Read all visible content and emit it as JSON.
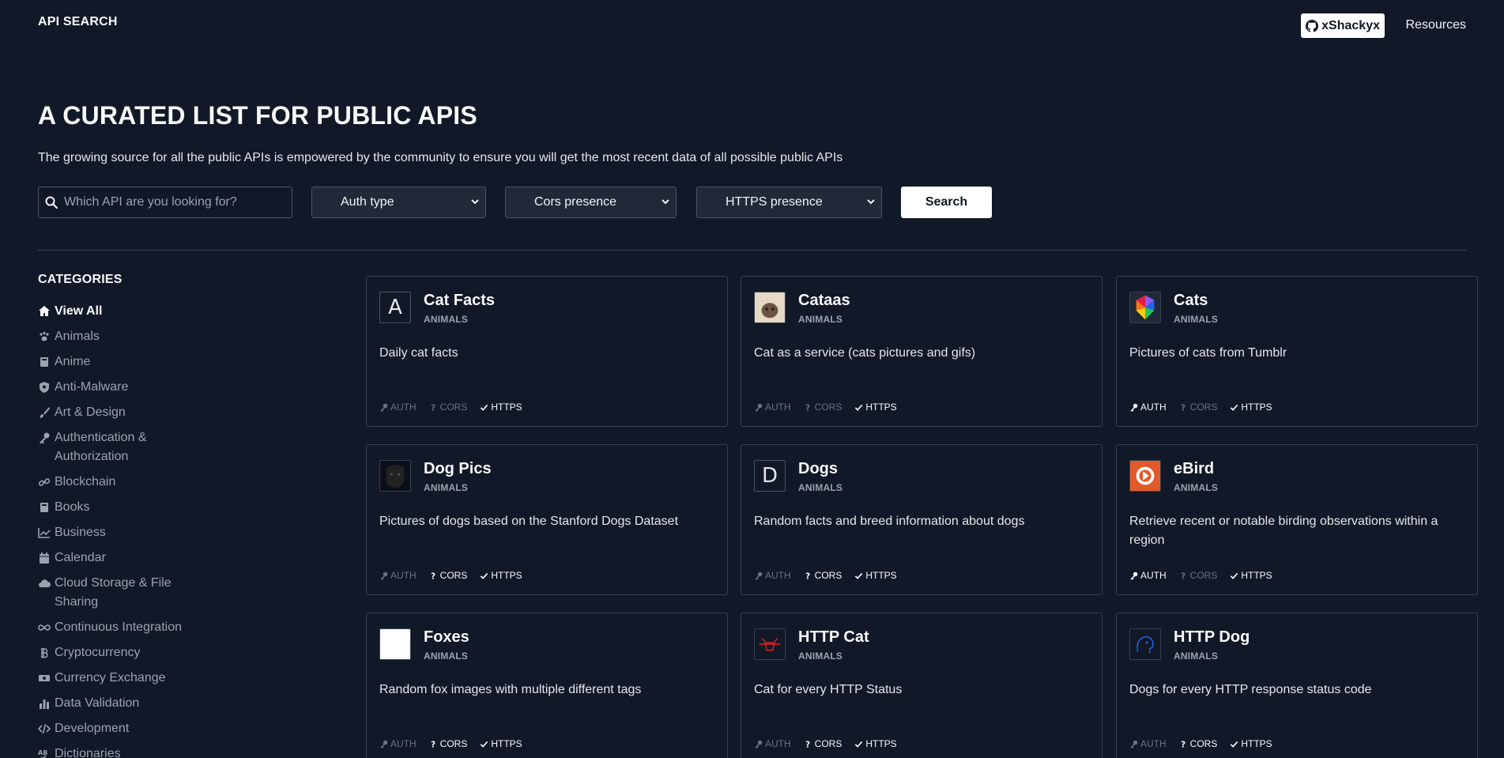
{
  "header": {
    "brand": "API SEARCH",
    "github_label": "xShackyx",
    "resources_label": "Resources"
  },
  "hero": {
    "title": "A CURATED LIST FOR PUBLIC APIS",
    "subtitle": "The growing source for all the public APIs is empowered by the community to ensure you will get the most recent data of all possible public APIs"
  },
  "filters": {
    "search_placeholder": "Which API are you looking for?",
    "auth_selected": "Auth type",
    "cors_selected": "Cors presence",
    "https_selected": "HTTPS presence",
    "search_button": "Search"
  },
  "sidebar": {
    "heading": "CATEGORIES",
    "items": [
      {
        "label": "View All",
        "icon": "home-icon"
      },
      {
        "label": "Animals",
        "icon": "paw-icon"
      },
      {
        "label": "Anime",
        "icon": "book-icon"
      },
      {
        "label": "Anti-Malware",
        "icon": "shield-icon"
      },
      {
        "label": "Art & Design",
        "icon": "brush-icon"
      },
      {
        "label": "Authentication & Authorization",
        "icon": "key-icon"
      },
      {
        "label": "Blockchain",
        "icon": "link-icon"
      },
      {
        "label": "Books",
        "icon": "book-icon"
      },
      {
        "label": "Business",
        "icon": "chart-icon"
      },
      {
        "label": "Calendar",
        "icon": "calendar-icon"
      },
      {
        "label": "Cloud Storage & File Sharing",
        "icon": "cloud-icon"
      },
      {
        "label": "Continuous Integration",
        "icon": "infinity-icon"
      },
      {
        "label": "Cryptocurrency",
        "icon": "bitcoin-icon"
      },
      {
        "label": "Currency Exchange",
        "icon": "money-icon"
      },
      {
        "label": "Data Validation",
        "icon": "bar-chart-icon"
      },
      {
        "label": "Development",
        "icon": "code-icon"
      },
      {
        "label": "Dictionaries",
        "icon": "spellcheck-icon"
      }
    ]
  },
  "tag_labels": {
    "auth": "AUTH",
    "cors": "CORS",
    "https": "HTTPS"
  },
  "cards": [
    {
      "name": "Cat Facts",
      "category": "ANIMALS",
      "description": "Daily cat facts",
      "logo_letter": "A",
      "auth": false,
      "cors": false,
      "https": true
    },
    {
      "name": "Cataas",
      "category": "ANIMALS",
      "description": "Cat as a service (cats pictures and gifs)",
      "logo_letter": "",
      "auth": false,
      "cors": false,
      "https": true
    },
    {
      "name": "Cats",
      "category": "ANIMALS",
      "description": "Pictures of cats from Tumblr",
      "logo_letter": "",
      "auth": true,
      "cors": false,
      "https": true
    },
    {
      "name": "Dog Pics",
      "category": "ANIMALS",
      "description": "Pictures of dogs based on the Stanford Dogs Dataset",
      "logo_letter": "",
      "auth": false,
      "cors": true,
      "https": true
    },
    {
      "name": "Dogs",
      "category": "ANIMALS",
      "description": "Random facts and breed information about dogs",
      "logo_letter": "D",
      "auth": false,
      "cors": true,
      "https": true
    },
    {
      "name": "eBird",
      "category": "ANIMALS",
      "description": "Retrieve recent or notable birding observations within a region",
      "logo_letter": "",
      "auth": true,
      "cors": false,
      "https": true
    },
    {
      "name": "Foxes",
      "category": "ANIMALS",
      "description": "Random fox images with multiple different tags",
      "logo_letter": "",
      "auth": false,
      "cors": true,
      "https": true
    },
    {
      "name": "HTTP Cat",
      "category": "ANIMALS",
      "description": "Cat for every HTTP Status",
      "logo_letter": "",
      "auth": false,
      "cors": true,
      "https": true
    },
    {
      "name": "HTTP Dog",
      "category": "ANIMALS",
      "description": "Dogs for every HTTP response status code",
      "logo_letter": "",
      "auth": false,
      "cors": true,
      "https": true
    }
  ]
}
